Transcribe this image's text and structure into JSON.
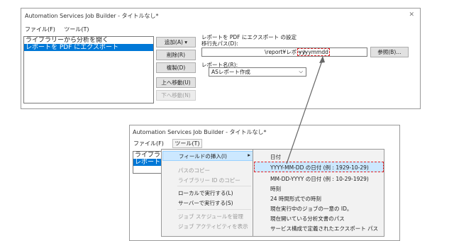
{
  "window1": {
    "title": "Automation Services Job Builder - タイトルなし*",
    "close_glyph": "✕",
    "menu": [
      "ファイル(F)",
      "ツール(T)"
    ],
    "list_items": [
      "ライブラリーから分析を開く",
      "レポートを PDF にエクスポート"
    ],
    "buttons": {
      "add": "追加(A)",
      "add_arrow": "▾",
      "delete": "削除(R)",
      "copy": "複製(D)",
      "move_up": "上へ移動(U)",
      "move_down": "下へ移動(N)",
      "browse": "参照(B)…"
    },
    "section_title": "レポートを PDF にエクスポート の設定",
    "dest_path_label": "移行先パス(D):",
    "dest_path_value": "\\report¥レポート",
    "dest_path_highlight": "yyyymmdd",
    "report_name_label": "レポート名(R):",
    "report_name_value": "ASレポート作成",
    "dropdown_glyph": "⌵"
  },
  "window2": {
    "title": "Automation Services Job Builder - タイトルなし*",
    "menu_file": "ファイル(F)",
    "menu_tools": "ツール(T)",
    "list_items": [
      "ライブラリ",
      "レポート"
    ],
    "tools_menu": {
      "insert_field": "フィールドの挿入(I)",
      "submenu_arrow": "▸",
      "copy_path": "パスのコピー",
      "copy_library_id": "ライブラリー ID のコピー",
      "run_local": "ローカルで実行する(L)",
      "run_server": "サーバーで実行する(S)",
      "manage_schedule": "ジョブ スケジュールを管理",
      "show_activity": "ジョブ アクティビティを表示"
    },
    "submenu": [
      "日付",
      "YYYY-MM-DD の日付 (例 : 1929-10-29)",
      "MM-DD-YYYY の日付 (例 : 10-29-1929)",
      "時刻",
      "24 時間形式での時刻",
      "現在実行中のジョブの一意の ID。",
      "現在開いている分析文書のパス",
      "サービス構成で定義されたエクスポート パス"
    ]
  },
  "colors": {
    "highlight_dash": "#e0262a",
    "selection": "#0078d7",
    "menu_hover": "#cce8ff",
    "arrow": "#666666"
  }
}
